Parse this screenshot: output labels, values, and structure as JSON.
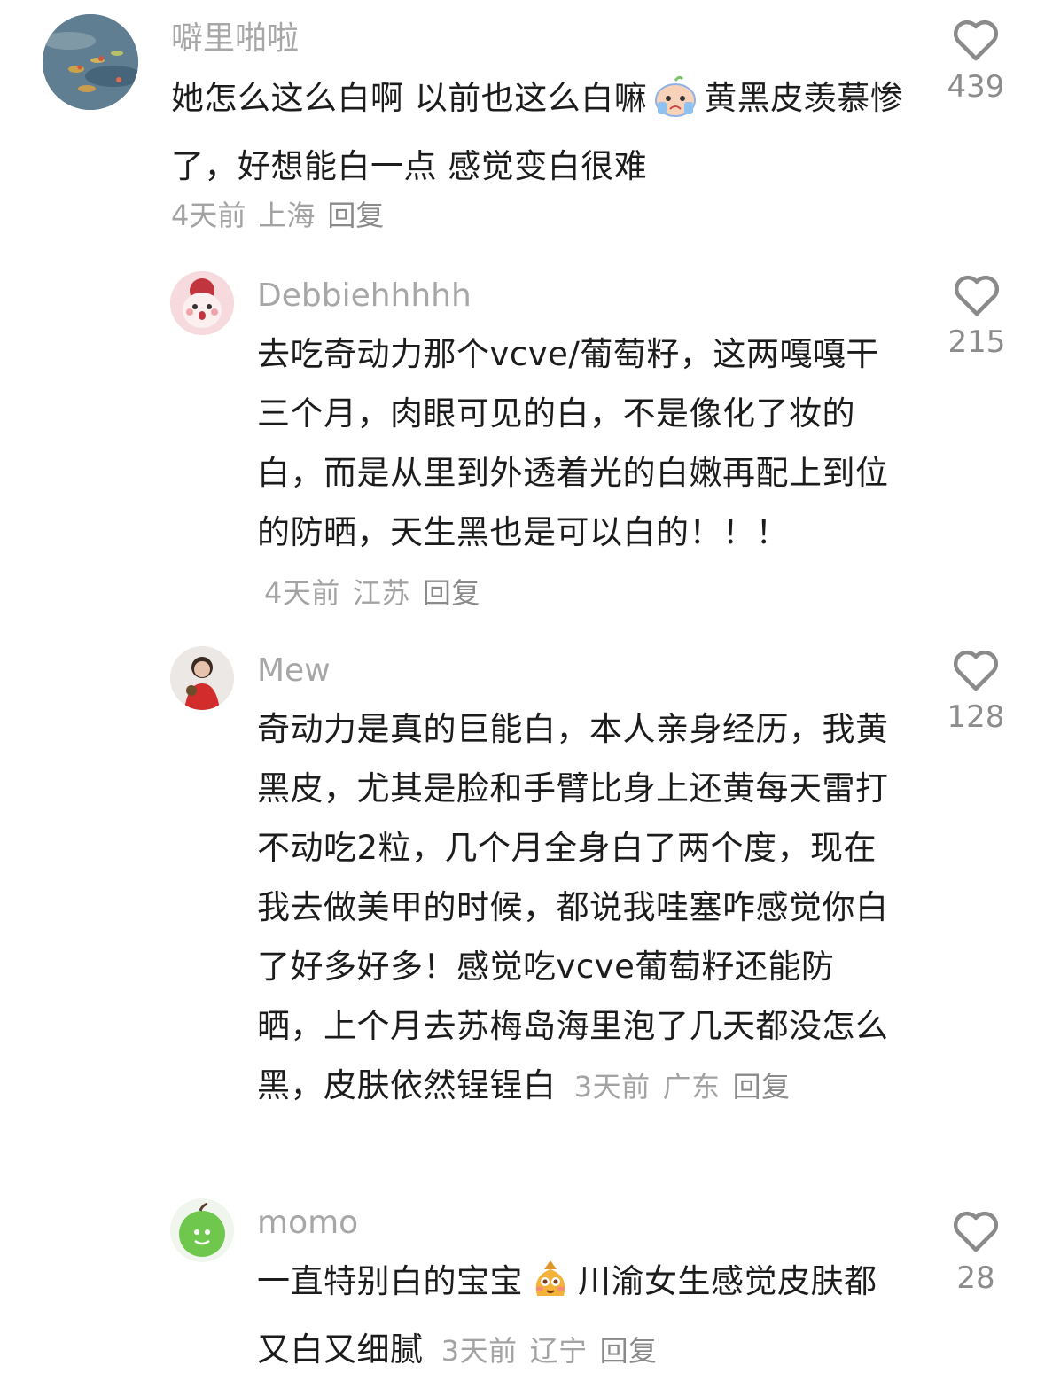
{
  "comments": [
    {
      "username": "噼里啪啦",
      "text_before_emoji": "她怎么这么白啊 以前也这么白嘛",
      "text_after_emoji": "黄黑皮羡慕惨了，好想能白一点 感觉变白很难",
      "time": "4天前",
      "location": "上海",
      "reply": "回复",
      "likes": "439",
      "avatar_icon": "water-lilies-painting-avatar",
      "emoji_icon": "crying-face-emoji"
    },
    {
      "username": "Debbiehhhhh",
      "text": "去吃奇动力那个vcve/葡萄籽，这两嘎嘎干三个月，肉眼可见的白，不是像化了妆的白，而是从里到外透着光的白嫩再配上到位的防晒，天生黑也是可以白的！！！",
      "time": "4天前",
      "location": "江苏",
      "reply": "回复",
      "likes": "215",
      "avatar_icon": "pink-bear-avatar"
    },
    {
      "username": "Mew",
      "text": "奇动力是真的巨能白，本人亲身经历，我黄黑皮，尤其是脸和手臂比身上还黄每天雷打不动吃2粒，几个月全身白了两个度，现在我去做美甲的时候，都说我哇塞咋感觉你白了好多好多！感觉吃vcve葡萄籽还能防晒，上个月去苏梅岛海里泡了几天都没怎么黑，皮肤依然锃锃白",
      "time": "3天前",
      "location": "广东",
      "reply": "回复",
      "likes": "128",
      "avatar_icon": "girl-portrait-avatar"
    },
    {
      "username": "momo",
      "text_before_emoji": "一直特别白的宝宝",
      "text_after_emoji": "川渝女生感觉皮肤都又白又细腻",
      "time": "3天前",
      "location": "辽宁",
      "reply": "回复",
      "likes": "28",
      "avatar_icon": "green-apple-avatar",
      "emoji_icon": "blushing-money-bag-emoji"
    }
  ]
}
